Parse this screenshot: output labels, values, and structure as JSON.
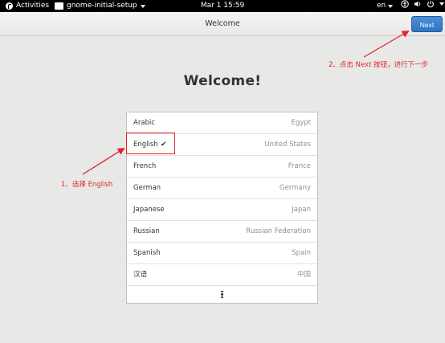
{
  "topbar": {
    "activities": "Activities",
    "app_name": "gnome-initial-setup",
    "clock": "Mar 1  15:59",
    "input_lang": "en"
  },
  "window": {
    "title": "Welcome",
    "next_label": "Next"
  },
  "page": {
    "heading": "Welcome!"
  },
  "languages": [
    {
      "name": "Arabic",
      "region": "Egypt",
      "selected": false
    },
    {
      "name": "English",
      "region": "United States",
      "selected": true
    },
    {
      "name": "French",
      "region": "France",
      "selected": false
    },
    {
      "name": "German",
      "region": "Germany",
      "selected": false
    },
    {
      "name": "Japanese",
      "region": "Japan",
      "selected": false
    },
    {
      "name": "Russian",
      "region": "Russian Federation",
      "selected": false
    },
    {
      "name": "Spanish",
      "region": "Spain",
      "selected": false
    },
    {
      "name": "汉语",
      "region": "中国",
      "selected": false
    }
  ],
  "check_glyph": "✔",
  "annotations": {
    "step1": "1、选择 English",
    "step2": "2、点击 Next 按钮，进行下一步",
    "color": "#e0252b"
  },
  "colors": {
    "accent": "#2d74c4",
    "background": "#e8e8e7"
  }
}
